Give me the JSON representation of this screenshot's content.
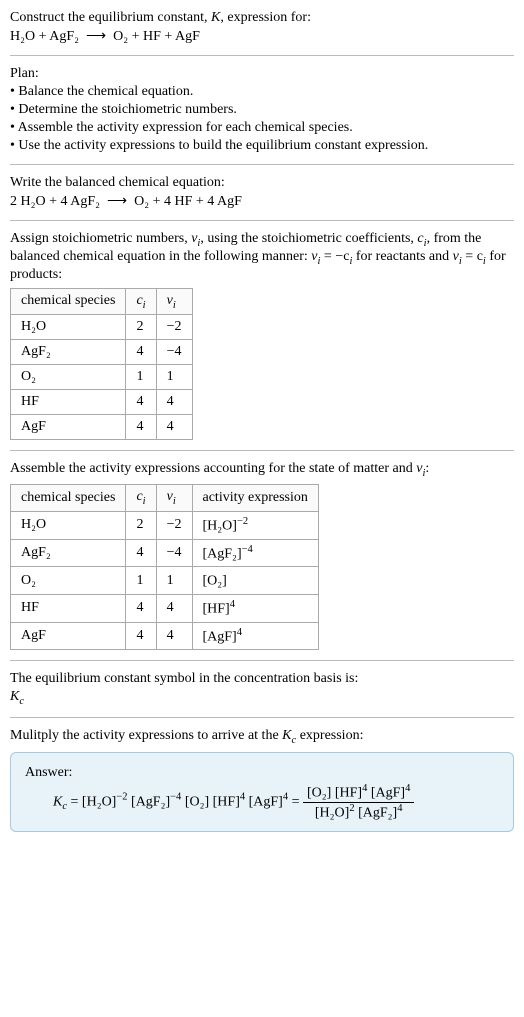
{
  "intro": {
    "line1": "Construct the equilibrium constant, ",
    "kital": "K",
    "line1b": ", expression for:",
    "equation_lhs": "H₂O + AgF₂",
    "arrow": "⟶",
    "equation_rhs": "O₂ + HF + AgF"
  },
  "plan": {
    "heading": "Plan:",
    "items": [
      "• Balance the chemical equation.",
      "• Determine the stoichiometric numbers.",
      "• Assemble the activity expression for each chemical species.",
      "• Use the activity expressions to build the equilibrium constant expression."
    ]
  },
  "balanced": {
    "heading": "Write the balanced chemical equation:",
    "lhs": "2 H₂O + 4 AgF₂",
    "arrow": "⟶",
    "rhs": "O₂ + 4 HF + 4 AgF"
  },
  "assign": {
    "text_a": "Assign stoichiometric numbers, ",
    "nu": "ν",
    "sub_i": "i",
    "text_b": ", using the stoichiometric coefficients, ",
    "c": "c",
    "text_c": ", from the balanced chemical equation in the following manner: ",
    "rel1_l": "ν",
    "rel1_r": " = −c",
    "rel1_end": " for reactants and ",
    "rel2_l": "ν",
    "rel2_r": " = c",
    "rel2_end": " for products:"
  },
  "table1": {
    "headers": {
      "species": "chemical species",
      "ci": "c",
      "nui": "ν",
      "sub": "i"
    },
    "rows": [
      {
        "species": "H₂O",
        "ci": "2",
        "nui": "−2"
      },
      {
        "species": "AgF₂",
        "ci": "4",
        "nui": "−4"
      },
      {
        "species": "O₂",
        "ci": "1",
        "nui": "1"
      },
      {
        "species": "HF",
        "ci": "4",
        "nui": "4"
      },
      {
        "species": "AgF",
        "ci": "4",
        "nui": "4"
      }
    ]
  },
  "assemble": {
    "text_a": "Assemble the activity expressions accounting for the state of matter and ",
    "nu": "ν",
    "sub": "i",
    "colon": ":"
  },
  "table2": {
    "headers": {
      "species": "chemical species",
      "ci": "c",
      "nui": "ν",
      "act": "activity expression",
      "sub": "i"
    },
    "rows": [
      {
        "species": "H₂O",
        "ci": "2",
        "nui": "−2",
        "base": "[H₂O]",
        "exp": "−2"
      },
      {
        "species": "AgF₂",
        "ci": "4",
        "nui": "−4",
        "base": "[AgF₂]",
        "exp": "−4"
      },
      {
        "species": "O₂",
        "ci": "1",
        "nui": "1",
        "base": "[O₂]",
        "exp": ""
      },
      {
        "species": "HF",
        "ci": "4",
        "nui": "4",
        "base": "[HF]",
        "exp": "4"
      },
      {
        "species": "AgF",
        "ci": "4",
        "nui": "4",
        "base": "[AgF]",
        "exp": "4"
      }
    ]
  },
  "kc_text": {
    "line": "The equilibrium constant symbol in the concentration basis is:",
    "sym": "K",
    "sub": "c"
  },
  "multiply": {
    "text_a": "Mulitply the activity expressions to arrive at the ",
    "k": "K",
    "sub": "c",
    "text_b": " expression:"
  },
  "answer": {
    "label": "Answer:",
    "kc": "K",
    "kcsub": "c",
    "eq": " = ",
    "t1": "[H₂O]",
    "e1": "−2",
    "t2": "[AgF₂]",
    "e2": "−4",
    "t3": "[O₂]",
    "t4": "[HF]",
    "e4": "4",
    "t5": "[AgF]",
    "e5": "4",
    "eq2": " = ",
    "num1": "[O₂]",
    "num2": "[HF]",
    "numE2": "4",
    "num3": "[AgF]",
    "numE3": "4",
    "den1": "[H₂O]",
    "denE1": "2",
    "den2": "[AgF₂]",
    "denE2": "4"
  }
}
